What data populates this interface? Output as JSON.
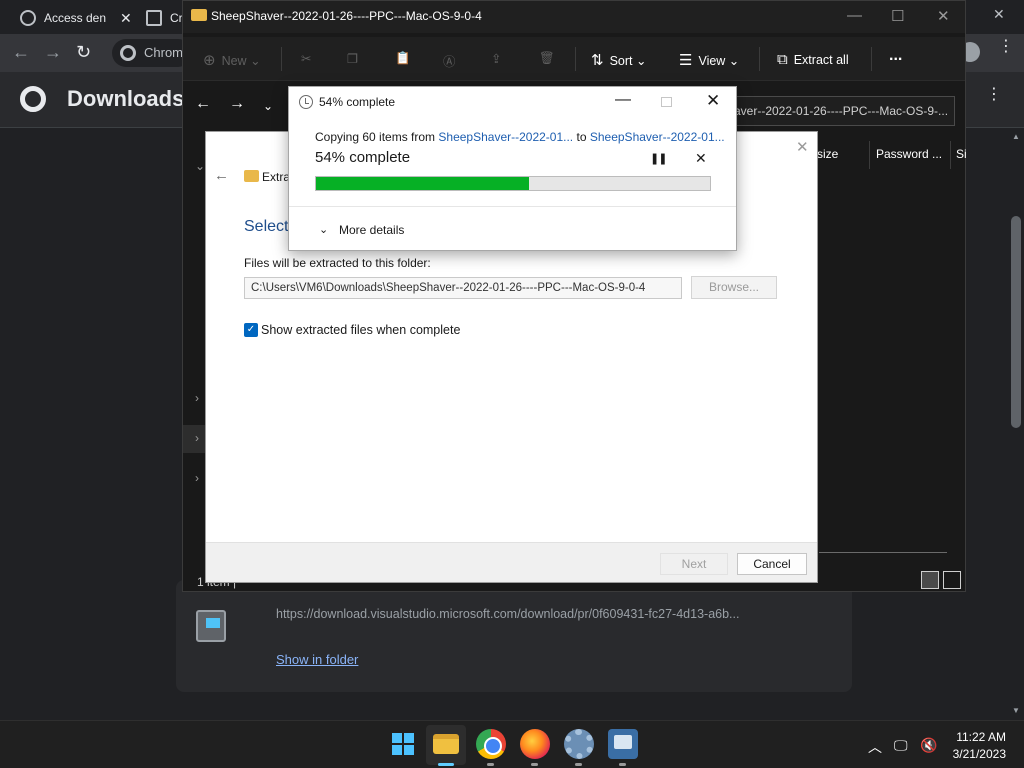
{
  "chrome": {
    "tabs": [
      {
        "label": "Access den"
      },
      {
        "label": "Cr"
      }
    ],
    "omnibox_text": "Chrom",
    "page_title": "Downloads",
    "download_url": "https://download.visualstudio.microsoft.com/download/pr/0f609431-fc27-4d13-a6b...",
    "show_in_folder": "Show in folder"
  },
  "explorer": {
    "title": "SheepShaver--2022-01-26----PPC---Mac-OS-9-0-4",
    "toolbar": {
      "new": "New",
      "sort": "Sort",
      "view": "View",
      "extract_all": "Extract all",
      "more": "..."
    },
    "search_text": "aver--2022-01-26----PPC---Mac-OS-9-...",
    "columns": {
      "size": "size",
      "password": "Password ...",
      "si": "Si"
    },
    "status_text": "1 item |"
  },
  "wizard": {
    "title": "Extra",
    "heading": "Select",
    "label": "Files will be extracted to this folder:",
    "path_value": "C:\\Users\\VM6\\Downloads\\SheepShaver--2022-01-26----PPC---Mac-OS-9-0-4",
    "browse": "Browse...",
    "checkbox_label": "Show extracted files when complete",
    "checkbox_checked": true,
    "next": "Next",
    "cancel": "Cancel"
  },
  "progress": {
    "title": "54% complete",
    "copy_prefix": "Copying 60 items from",
    "copy_source": "SheepShaver--2022-01...",
    "copy_to": "to",
    "copy_dest": "SheepShaver--2022-01...",
    "percent_text": "54% complete",
    "percent": 54,
    "more_details": "More details",
    "fill_color": "#06b025"
  },
  "taskbar": {
    "time": "11:22 AM",
    "date": "3/21/2023"
  }
}
